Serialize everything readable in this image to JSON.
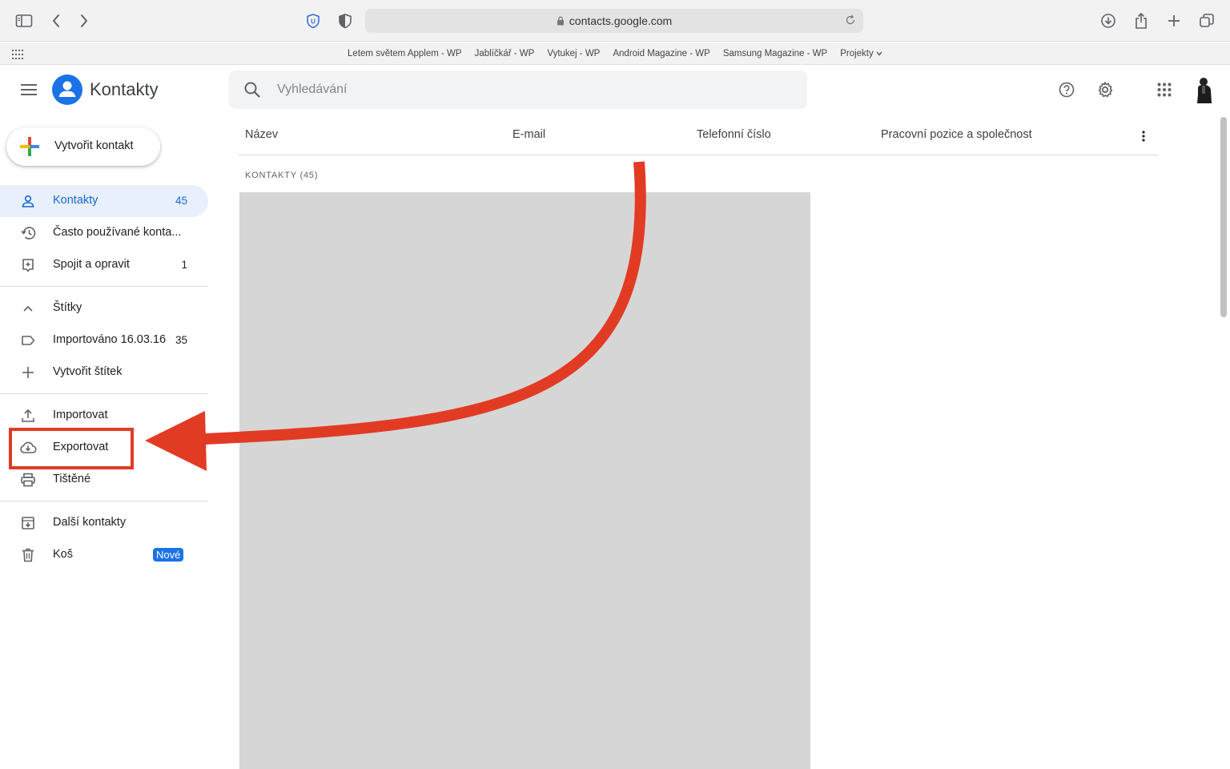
{
  "browser": {
    "url": "contacts.google.com",
    "bookmarks": [
      "Letem světem Applem - WP",
      "Jablíčkář - WP",
      "Vytukej - WP",
      "Android Magazine - WP",
      "Samsung Magazine - WP",
      "Projekty"
    ]
  },
  "app": {
    "title": "Kontakty",
    "search_placeholder": "Vyhledávání"
  },
  "sidebar": {
    "create_label": "Vytvořit kontakt",
    "items": [
      {
        "label": "Kontakty",
        "count": "45"
      },
      {
        "label": "Často používané konta..."
      },
      {
        "label": "Spojit a opravit",
        "count": "1"
      },
      {
        "label": "Štítky"
      },
      {
        "label": "Importováno 16.03.16",
        "count": "35"
      },
      {
        "label": "Vytvořit štítek"
      },
      {
        "label": "Importovat"
      },
      {
        "label": "Exportovat"
      },
      {
        "label": "Tištěné"
      },
      {
        "label": "Další kontakty"
      },
      {
        "label": "Koš",
        "badge": "Nové"
      }
    ]
  },
  "table": {
    "columns": [
      "Název",
      "E-mail",
      "Telefonní číslo",
      "Pracovní pozice a společnost"
    ],
    "section_label": "KONTAKTY (45)"
  },
  "colors": {
    "accent": "#1a73e8",
    "active_bg": "#e8f0fe",
    "annotation": "#e23b24"
  }
}
